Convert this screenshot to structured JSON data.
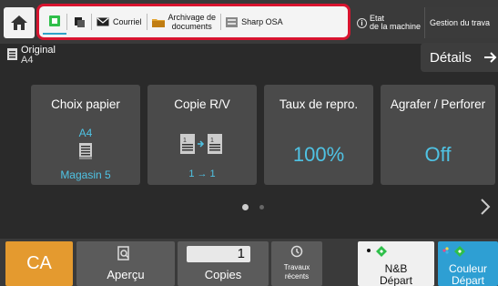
{
  "header": {
    "tabs": [
      {
        "id": "copy",
        "label": "",
        "icon": "copy-mode-icon",
        "active": true
      },
      {
        "id": "scan",
        "label": "",
        "icon": "scan-icon",
        "active": false
      },
      {
        "id": "email",
        "label": "Courriel",
        "icon": "envelope-icon",
        "active": false
      },
      {
        "id": "archive",
        "label": "Archivage de documents",
        "label_line1": "Archivage de",
        "label_line2": "documents",
        "icon": "folder-icon",
        "active": false
      },
      {
        "id": "osa",
        "label": "Sharp OSA",
        "icon": "sharp-osa-icon",
        "active": false
      }
    ],
    "etat_line1": "Etat",
    "etat_line2": "de la machine",
    "gestion_label": "Gestion du trava"
  },
  "original": {
    "label": "Original",
    "value": "A4"
  },
  "details_label": "Détails",
  "tiles": {
    "papier": {
      "title": "Choix papier",
      "size": "A4",
      "tray": "Magasin 5"
    },
    "copie": {
      "title": "Copie R/V",
      "mode": "1 → 1"
    },
    "taux": {
      "title": "Taux de repro.",
      "value": "100%"
    },
    "agrafer": {
      "title": "Agrafer / Perforer",
      "value": "Off"
    }
  },
  "pager": {
    "page": 1,
    "total": 2
  },
  "bottom": {
    "ca_label": "CA",
    "apercu_label": "Aperçu",
    "copies_value": "1",
    "copies_label": "Copies",
    "travaux_line1": "Travaux",
    "travaux_line2": "récents",
    "nb_line1": "N&B",
    "nb_line2": "Départ",
    "couleur_line1": "Couleur",
    "couleur_line2": "Départ"
  },
  "colors": {
    "accent": "#4fc3e4",
    "ca": "#e49a2f",
    "couleur": "#2e9fd3",
    "highlight": "#d8142f",
    "start_green": "#2fbf4a"
  }
}
